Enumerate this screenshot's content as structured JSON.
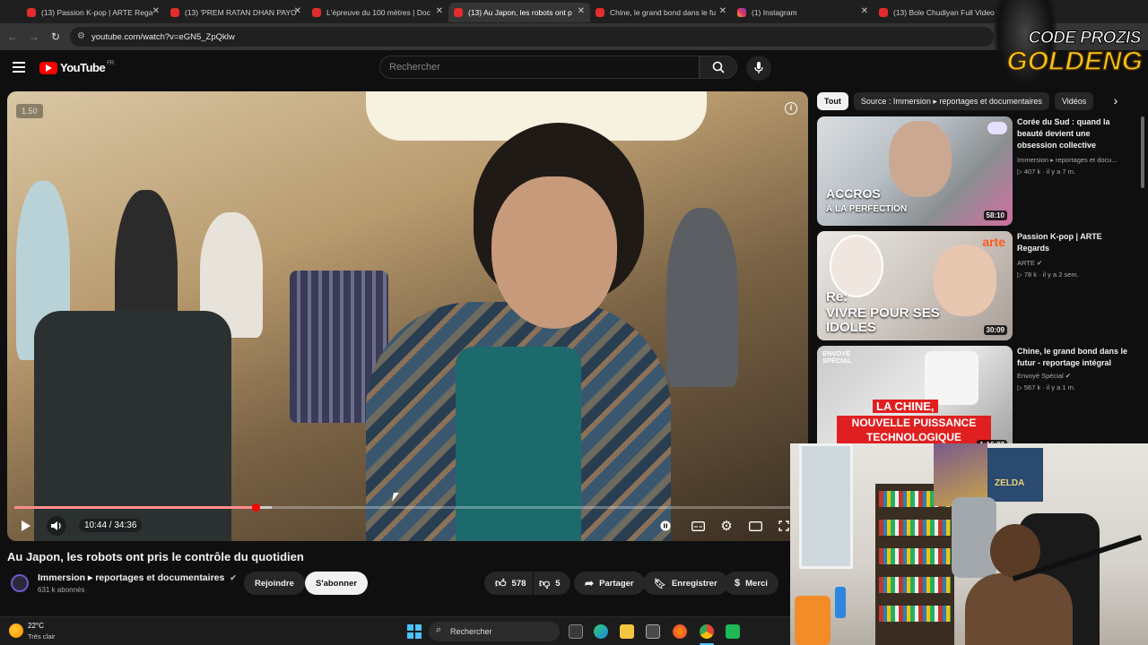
{
  "browser": {
    "tabs": [
      {
        "label": "(13) Passion K-pop | ARTE Rega",
        "icon": "youtube-favicon"
      },
      {
        "label": "(13) 'PREM RATAN DHAN PAYO",
        "icon": "youtube-favicon"
      },
      {
        "label": "L'épreuve du 100 mètres | Doc",
        "icon": "youtube-favicon"
      },
      {
        "label": "(13) Au Japon, les robots ont p",
        "icon": "youtube-favicon",
        "active": true
      },
      {
        "label": "Chine, le grand bond dans le fu",
        "icon": "youtube-favicon"
      },
      {
        "label": "(1) Instagram",
        "icon": "instagram-favicon"
      },
      {
        "label": "(13) Bole Chudiyan Full Video",
        "icon": "youtube-favicon"
      }
    ],
    "url": "youtube.com/watch?v=eGN5_ZpQklw"
  },
  "youtube": {
    "logo_text": "YouTube",
    "logo_region": "FR",
    "search_placeholder": "Rechercher"
  },
  "player": {
    "speed": "1.50",
    "time": "10:44 / 34:36",
    "progress_fraction": 0.31,
    "buffer_fraction": 0.33
  },
  "video": {
    "title": "Au Japon, les robots ont pris le contrôle du quotidien",
    "channel": "Immersion ▸ reportages et documentaires",
    "subscribers": "631 k abonnés",
    "join_label": "Rejoindre",
    "subscribe_label": "S'abonner",
    "likes": "578",
    "dislikes": "5",
    "share_label": "Partager",
    "save_label": "Enregistrer",
    "thanks_label": "Merci"
  },
  "sidebar": {
    "chips": [
      "Tout",
      "Source : Immersion ▸ reportages et documentaires",
      "Vidéos"
    ],
    "recommendations": [
      {
        "title": "Corée du Sud : quand la beauté devient une obsession collective",
        "channel": "Immersion ▸ reportages et docu...",
        "stats": "407 k · il y a 7 m.",
        "duration": "58:10",
        "thumb_text_1": "ACCROS",
        "thumb_text_2": "À LA PERFECTION"
      },
      {
        "title": "Passion K-pop | ARTE Regards",
        "channel": "ARTE",
        "stats": "78 k · il y a 2 sem.",
        "duration": "30:09",
        "thumb_text_1": "Re:",
        "thumb_text_2": "VIVRE POUR SES IDOLES",
        "thumb_brand": "arte"
      },
      {
        "title": "Chine, le grand bond dans le futur - reportage intégral",
        "channel": "Envoyé Spécial",
        "stats": "567 k · il y a 1 m.",
        "duration": "1:16:03",
        "thumb_text_0": "ENVOYÉ SPÉCIAL",
        "thumb_text_1": "LA CHINE,",
        "thumb_text_2": "NOUVELLE PUISSANCE TECHNOLOGIQUE"
      }
    ]
  },
  "overlay": {
    "brand_line1": "CODE PROZIS",
    "brand_line2": "GOLDENG",
    "poster_text": "ZELDA"
  },
  "taskbar": {
    "temperature": "22°C",
    "weather": "Très clair",
    "search_label": "Rechercher"
  }
}
